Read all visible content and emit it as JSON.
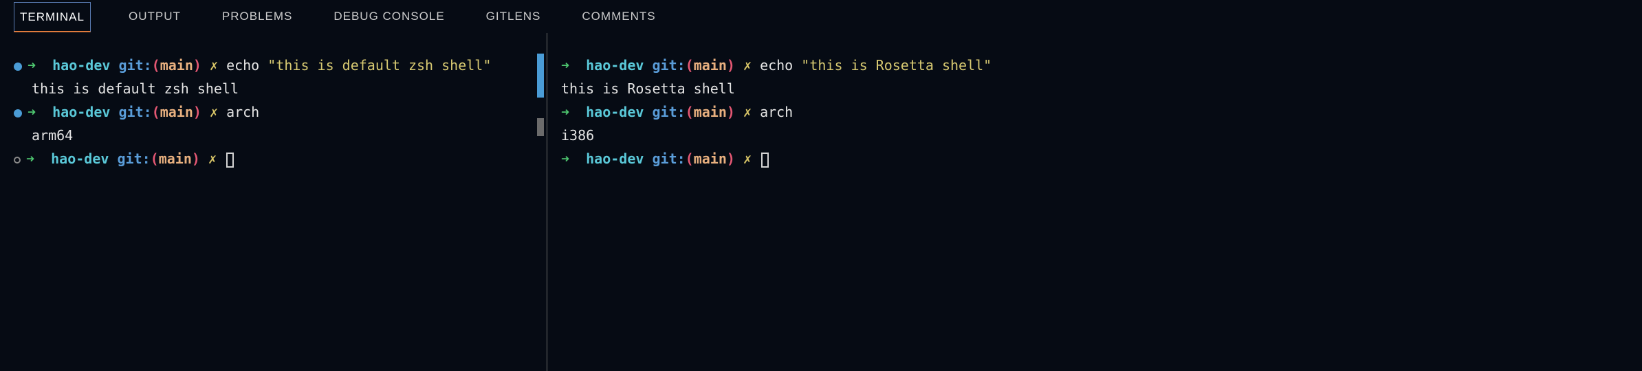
{
  "tabs": {
    "terminal": "TERMINAL",
    "output": "OUTPUT",
    "problems": "PROBLEMS",
    "debug_console": "DEBUG CONSOLE",
    "gitlens": "GITLENS",
    "comments": "COMMENTS"
  },
  "prompt": {
    "arrow": "➜",
    "dir": "hao-dev",
    "git_label": "git:",
    "paren_open": "(",
    "branch": "main",
    "paren_close": ")",
    "cross": "✗"
  },
  "left": {
    "cmd1": "echo ",
    "str1": "\"this is default zsh shell\"",
    "out1": "this is default zsh shell",
    "cmd2": "arch",
    "out2": "arm64"
  },
  "right": {
    "cmd1": "echo ",
    "str1": "\"this is Rosetta shell\"",
    "out1": "this is Rosetta shell",
    "cmd2": "arch",
    "out2": "i386"
  }
}
